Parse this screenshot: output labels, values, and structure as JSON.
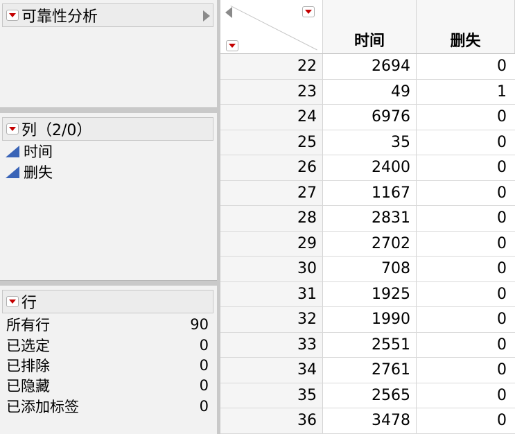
{
  "reliability_panel": {
    "title": "可靠性分析"
  },
  "columns_panel": {
    "title": "列（2/0）",
    "items": [
      {
        "label": "时间",
        "icon": "continuous-icon"
      },
      {
        "label": "删失",
        "icon": "continuous-icon"
      }
    ]
  },
  "rows_panel": {
    "title": "行",
    "stats": [
      {
        "label": "所有行",
        "value": "90"
      },
      {
        "label": "已选定",
        "value": "0"
      },
      {
        "label": "已排除",
        "value": "0"
      },
      {
        "label": "已隐藏",
        "value": "0"
      },
      {
        "label": "已添加标签",
        "value": "0"
      }
    ]
  },
  "table": {
    "headers": {
      "time": "时间",
      "censor": "删失"
    },
    "rows": [
      {
        "id": "22",
        "time": "2694",
        "censor": "0"
      },
      {
        "id": "23",
        "time": "49",
        "censor": "1"
      },
      {
        "id": "24",
        "time": "6976",
        "censor": "0"
      },
      {
        "id": "25",
        "time": "35",
        "censor": "0"
      },
      {
        "id": "26",
        "time": "2400",
        "censor": "0"
      },
      {
        "id": "27",
        "time": "1167",
        "censor": "0"
      },
      {
        "id": "28",
        "time": "2831",
        "censor": "0"
      },
      {
        "id": "29",
        "time": "2702",
        "censor": "0"
      },
      {
        "id": "30",
        "time": "708",
        "censor": "0"
      },
      {
        "id": "31",
        "time": "1925",
        "censor": "0"
      },
      {
        "id": "32",
        "time": "1990",
        "censor": "0"
      },
      {
        "id": "33",
        "time": "2551",
        "censor": "0"
      },
      {
        "id": "34",
        "time": "2761",
        "censor": "0"
      },
      {
        "id": "35",
        "time": "2565",
        "censor": "0"
      },
      {
        "id": "36",
        "time": "3478",
        "censor": "0"
      }
    ]
  },
  "colors": {
    "accent_red": "#c40000",
    "column_icon_blue": "#3a64b7"
  }
}
